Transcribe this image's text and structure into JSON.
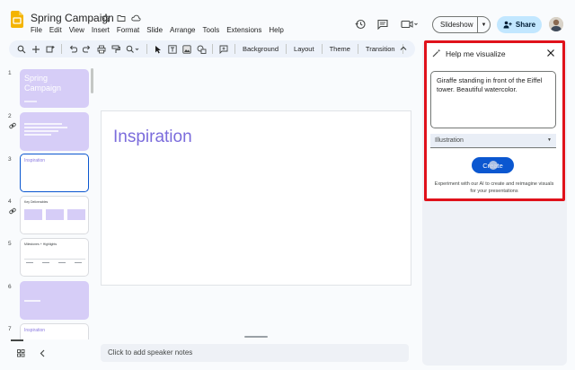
{
  "app": {
    "doc_title": "Spring Campaign",
    "menu": [
      "File",
      "Edit",
      "View",
      "Insert",
      "Format",
      "Slide",
      "Arrange",
      "Tools",
      "Extensions",
      "Help"
    ]
  },
  "header": {
    "slideshow_label": "Slideshow",
    "share_label": "Share"
  },
  "toolbar": {
    "background_label": "Background",
    "layout_label": "Layout",
    "theme_label": "Theme",
    "transition_label": "Transition"
  },
  "filmstrip": {
    "slides": [
      {
        "num": "1",
        "text": "Spring Campaign"
      },
      {
        "num": "2",
        "text": ""
      },
      {
        "num": "3",
        "text": "Inspiration"
      },
      {
        "num": "4",
        "text": "Key Deliverables"
      },
      {
        "num": "5",
        "text": "Milestones + Highlights"
      },
      {
        "num": "6",
        "text": ""
      },
      {
        "num": "7",
        "text": "Inspiration"
      }
    ]
  },
  "canvas": {
    "slide_title": "Inspiration",
    "notes_placeholder": "Click to add speaker notes"
  },
  "panel": {
    "title": "Help me visualize",
    "prompt_text": "Giraffe standing in front of the Eiffel tower. Beautiful watercolor.",
    "style_value": "Illustration",
    "create_label": "Create",
    "note": "Experiment with our AI to create and reimagine visuals for your presentations"
  },
  "colors": {
    "accent": "#0b57d0",
    "slide_title": "#7b6cdc",
    "highlight_border": "#e0121b",
    "thumb_purple": "#d6cdf7",
    "share_bg": "#c2e7ff"
  }
}
